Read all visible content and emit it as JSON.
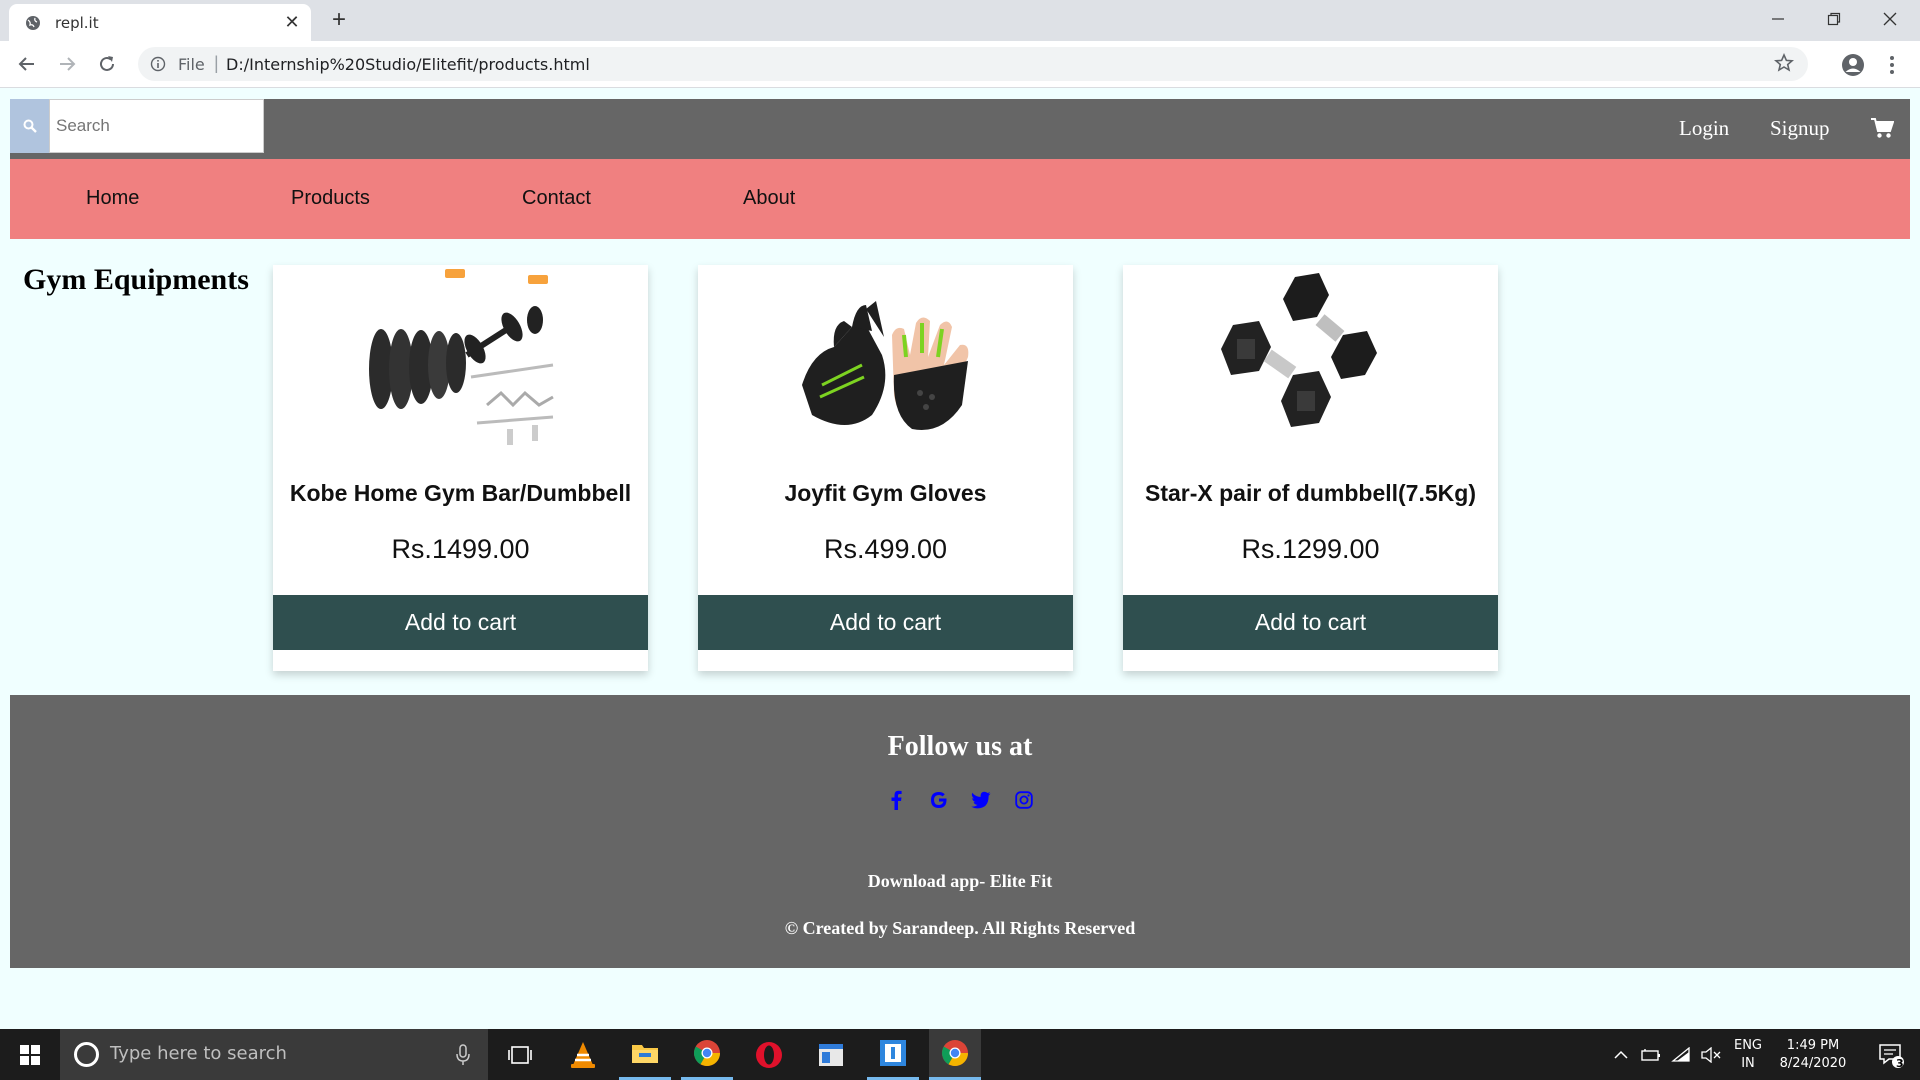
{
  "browser": {
    "tab_title": "repl.it",
    "new_tab_symbol": "+",
    "close_tab_symbol": "✕",
    "file_label": "File",
    "url": "D:/Internship%20Studio/Elitefit/products.html"
  },
  "topnav": {
    "search_placeholder": "Search",
    "login_label": "Login",
    "signup_label": "Signup"
  },
  "menu": {
    "items": [
      {
        "label": "Home"
      },
      {
        "label": "Products"
      },
      {
        "label": "Contact"
      },
      {
        "label": "About"
      }
    ]
  },
  "main": {
    "section_title": "Gym Equipments",
    "products": [
      {
        "name": "Kobe Home Gym Bar/Dumbbell",
        "price": "Rs.1499.00",
        "button_label": "Add to cart",
        "image": "home-gym-set-image"
      },
      {
        "name": "Joyfit Gym Gloves",
        "price": "Rs.499.00",
        "button_label": "Add to cart",
        "image": "gym-gloves-image"
      },
      {
        "name": "Star-X pair of dumbbell(7.5Kg)",
        "price": "Rs.1299.00",
        "button_label": "Add to cart",
        "image": "hex-dumbbells-image"
      }
    ]
  },
  "footer": {
    "title": "Follow us at",
    "social_icons": [
      "facebook-icon",
      "google-icon",
      "twitter-icon",
      "instagram-icon"
    ],
    "download_text": "Download app- Elite Fit",
    "copyright": "© Created by Sarandeep. All Rights Reserved"
  },
  "taskbar": {
    "search_placeholder": "Type here to search",
    "lang_top": "ENG",
    "lang_bottom": "IN",
    "time": "1:49 PM",
    "date": "8/24/2020",
    "notification_count": "3"
  },
  "colors": {
    "topnav_bg": "#666666",
    "menu_bg": "#f08080",
    "button_bg": "#2f4f4f",
    "page_bg": "#f0ffff",
    "search_btn_bg": "#b0c4de",
    "social_icon": "#0000ff"
  }
}
